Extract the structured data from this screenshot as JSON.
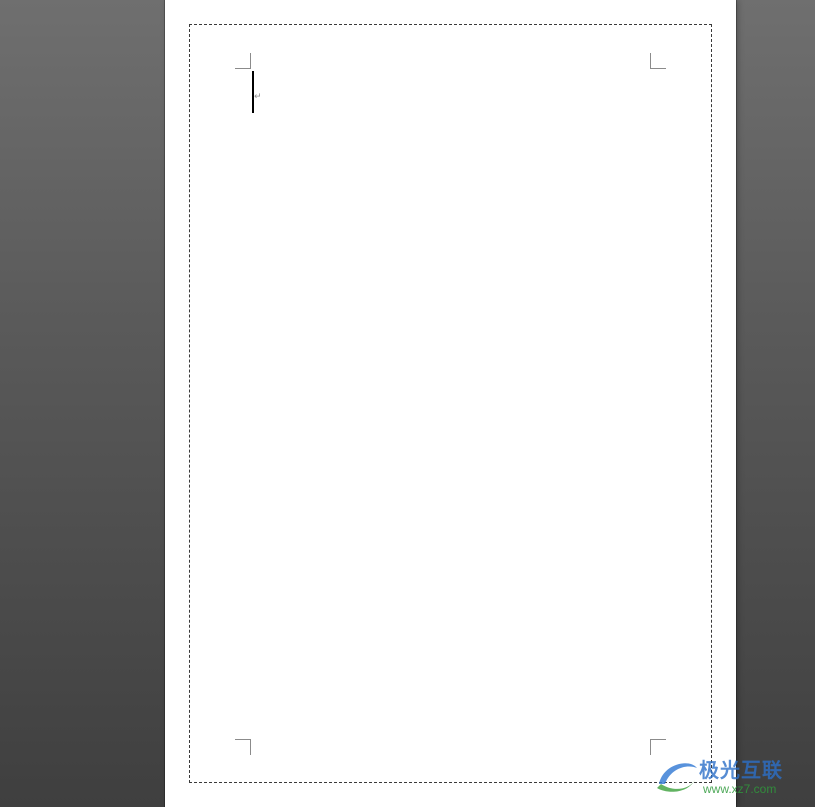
{
  "document": {
    "paragraph_mark": "↵"
  },
  "watermark": {
    "brand": "极光互联",
    "url": "www.xz7.com",
    "logo_icon": "aurora-logo-icon",
    "colors": {
      "brand": "#2c70c9",
      "url": "#2f9a3c"
    }
  },
  "colors": {
    "workspace_top": "#6f6f6f",
    "workspace_bottom": "#3f3f3f",
    "page": "#ffffff"
  }
}
